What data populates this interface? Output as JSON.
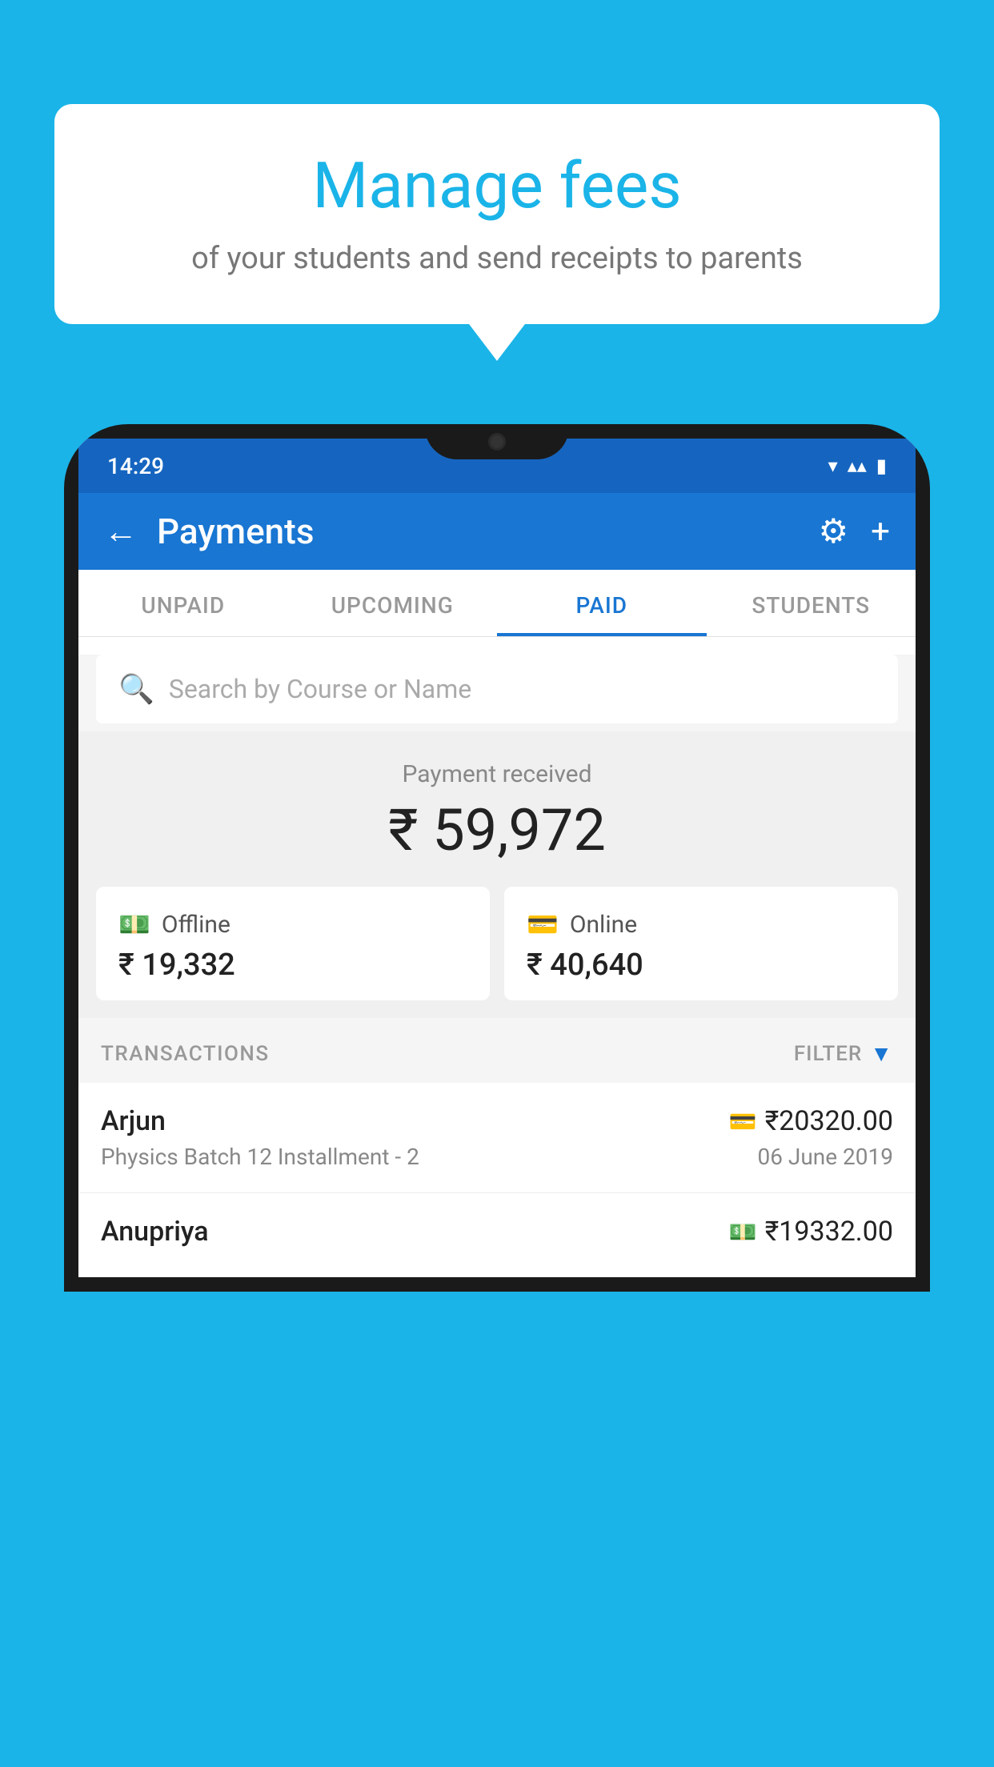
{
  "background_color": "#1ab4e8",
  "speech_bubble": {
    "title": "Manage fees",
    "subtitle": "of your students and send receipts to parents"
  },
  "status_bar": {
    "time": "14:29",
    "wifi_icon": "▼",
    "signal_icon": "▲",
    "battery_icon": "▮"
  },
  "header": {
    "title": "Payments",
    "back_label": "←",
    "settings_icon": "⚙",
    "add_icon": "+"
  },
  "tabs": [
    {
      "label": "UNPAID",
      "active": false
    },
    {
      "label": "UPCOMING",
      "active": false
    },
    {
      "label": "PAID",
      "active": true
    },
    {
      "label": "STUDENTS",
      "active": false
    }
  ],
  "search": {
    "placeholder": "Search by Course or Name"
  },
  "payment_received": {
    "label": "Payment received",
    "amount": "₹ 59,972",
    "offline_label": "Offline",
    "offline_amount": "₹ 19,332",
    "online_label": "Online",
    "online_amount": "₹ 40,640"
  },
  "transactions": {
    "section_label": "TRANSACTIONS",
    "filter_label": "FILTER",
    "items": [
      {
        "name": "Arjun",
        "amount": "₹20320.00",
        "course": "Physics Batch 12 Installment - 2",
        "date": "06 June 2019",
        "payment_type": "card"
      },
      {
        "name": "Anupriya",
        "amount": "₹19332.00",
        "course": "",
        "date": "",
        "payment_type": "cash"
      }
    ]
  }
}
